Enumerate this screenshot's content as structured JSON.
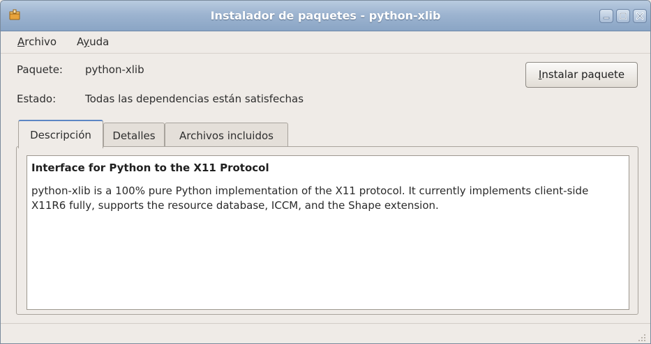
{
  "window": {
    "title": "Instalador de paquetes - python-xlib"
  },
  "menubar": {
    "items": [
      {
        "label": "Archivo",
        "mnemonic": "A",
        "rest": "rchivo"
      },
      {
        "label": "Ayuda",
        "pre": "A",
        "mnemonic": "y",
        "rest": "uda"
      }
    ]
  },
  "info": {
    "package_label": "Paquete:",
    "package_value": "python-xlib",
    "status_label": "Estado:",
    "status_value": "Todas las dependencias están satisfechas"
  },
  "install_button": {
    "label": "Instalar paquete",
    "mnemonic": "I",
    "rest": "nstalar paquete"
  },
  "tabs": [
    {
      "label": "Descripción",
      "active": true
    },
    {
      "label": "Detalles",
      "active": false
    },
    {
      "label": "Archivos incluidos",
      "active": false
    }
  ],
  "description": {
    "title": "Interface for Python to the X11 Protocol",
    "body": "python-xlib is a 100% pure Python implementation of the X11 protocol. It currently implements client-side X11R6 fully, supports the resource database, ICCM, and the Shape extension."
  },
  "colors": {
    "titlebar": "#9db4d0",
    "window_bg": "#efebe7",
    "active_tab_accent": "#5c86c4"
  },
  "icons": {
    "app": "package-icon",
    "minimize": "minimize-icon",
    "maximize": "maximize-icon",
    "close": "close-icon",
    "grip": "resize-grip-icon"
  }
}
